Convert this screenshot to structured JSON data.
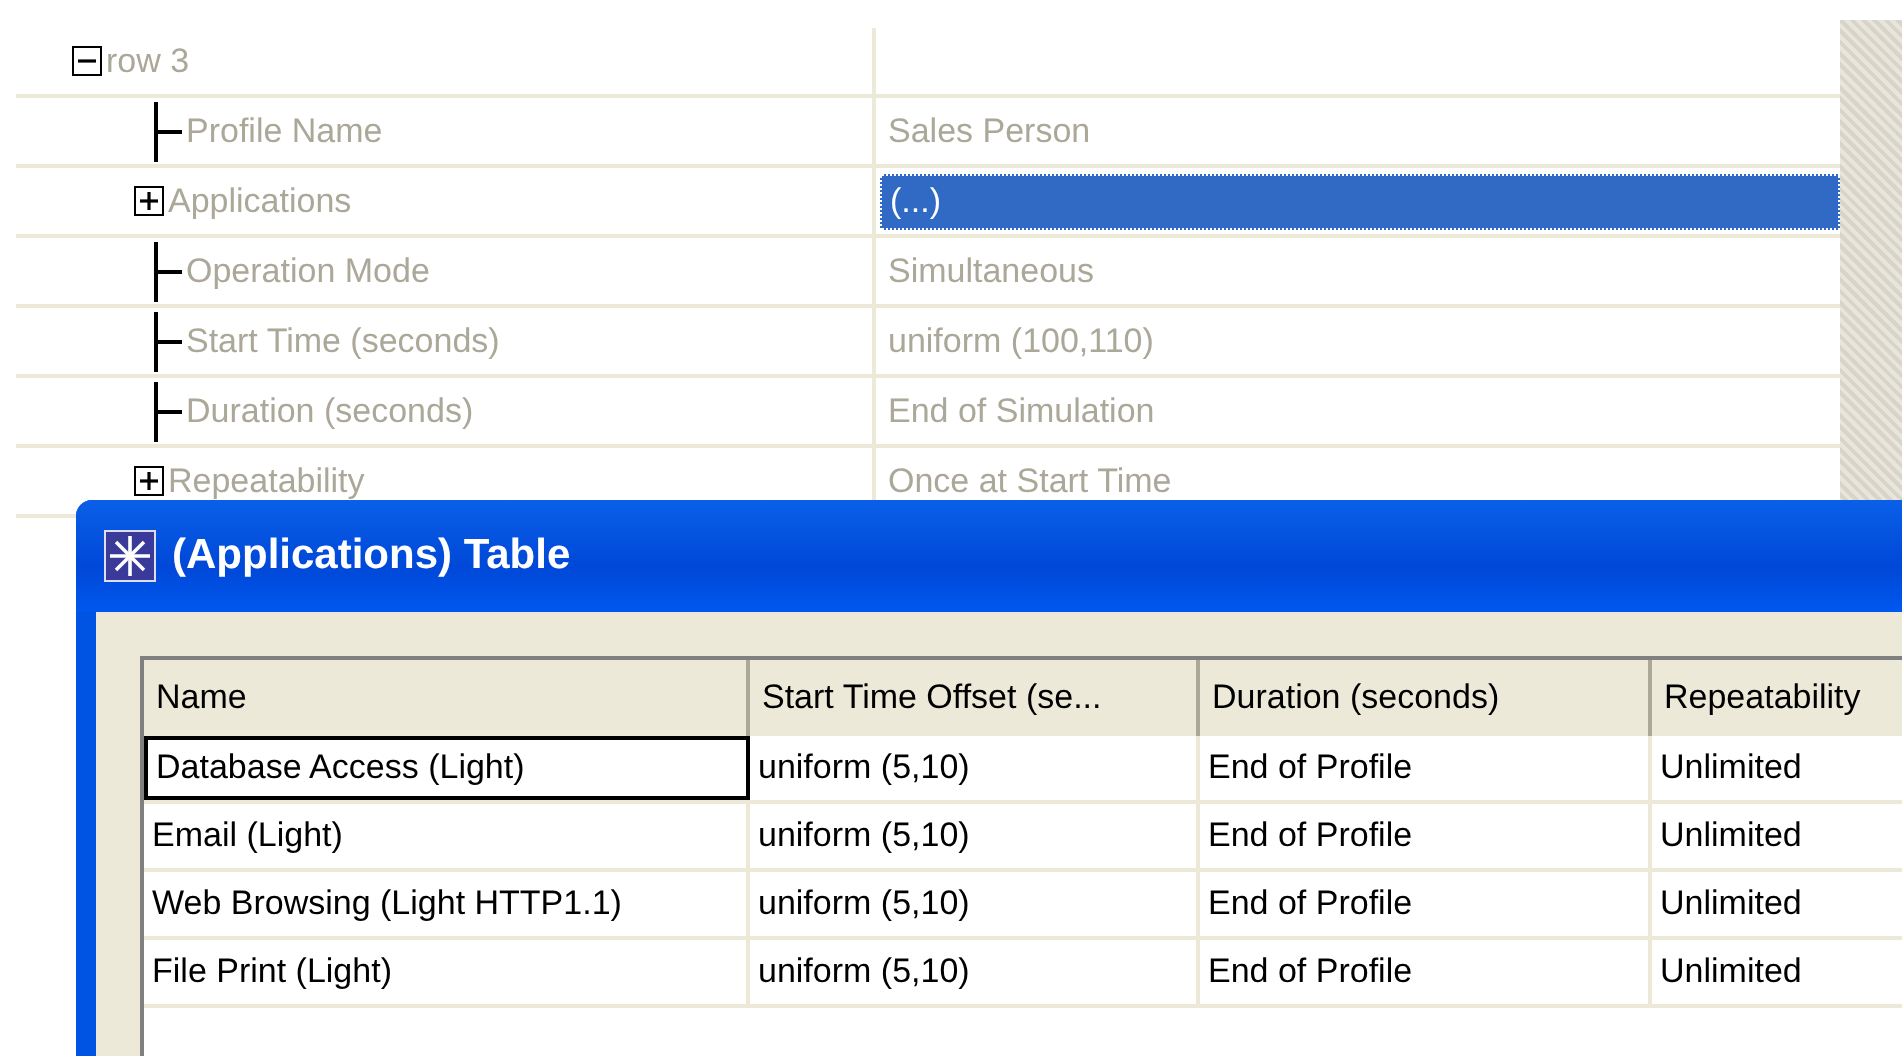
{
  "tree": {
    "label": "row 3",
    "expanded": true,
    "children": [
      {
        "label": "Profile Name",
        "kind": "leaf",
        "value": "Sales Person",
        "selected": false
      },
      {
        "label": "Applications",
        "kind": "group",
        "expanded": false,
        "value": "(...)",
        "selected": true
      },
      {
        "label": "Operation Mode",
        "kind": "leaf",
        "value": "Simultaneous",
        "selected": false
      },
      {
        "label": "Start Time (seconds)",
        "kind": "leaf",
        "value": "uniform (100,110)",
        "selected": false
      },
      {
        "label": "Duration (seconds)",
        "kind": "leaf",
        "value": "End of Simulation",
        "selected": false
      },
      {
        "label": "Repeatability",
        "kind": "group",
        "expanded": false,
        "value": "Once at Start Time",
        "selected": false
      }
    ]
  },
  "dialog": {
    "title": "(Applications) Table",
    "table": {
      "columns": [
        "Name",
        "Start Time Offset (se...",
        "Duration (seconds)",
        "Repeatability"
      ],
      "rows": [
        {
          "cells": [
            "Database Access (Light)",
            "uniform (5,10)",
            "End of Profile",
            "Unlimited"
          ],
          "focused": true
        },
        {
          "cells": [
            "Email (Light)",
            "uniform (5,10)",
            "End of Profile",
            "Unlimited"
          ],
          "focused": false
        },
        {
          "cells": [
            "Web Browsing (Light HTTP1.1)",
            "uniform (5,10)",
            "End of Profile",
            "Unlimited"
          ],
          "focused": false
        },
        {
          "cells": [
            "File Print (Light)",
            "uniform (5,10)",
            "End of Profile",
            "Unlimited"
          ],
          "focused": false
        }
      ]
    }
  }
}
